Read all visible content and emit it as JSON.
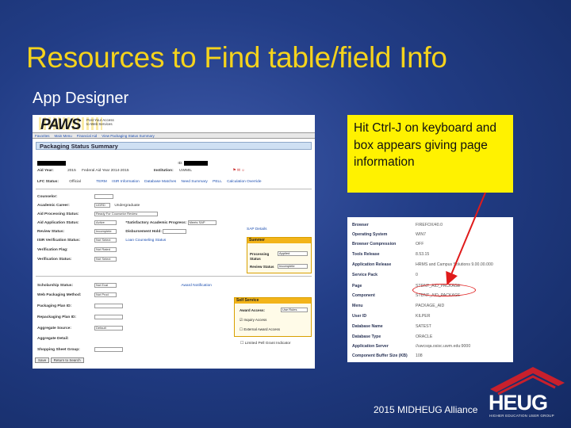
{
  "slide": {
    "title": "Resources to Find table/field Info",
    "subtitle": "App Designer",
    "note": "Hit Ctrl-J on keyboard and box appears giving page information",
    "footer": "2015 MIDHEUG Alliance"
  },
  "colors": {
    "title": "#f5d31c",
    "note_bg": "#fff200",
    "highlight": "#e01b1b",
    "logo_red": "#c8202c"
  },
  "paws": {
    "logo": "PAWS",
    "tagline": "Post Your Access\nto Web Services",
    "nav": [
      "Favorites",
      "Main Menu",
      "Financial Aid",
      "View Packaging Status Summary"
    ],
    "page_title": "Packaging Status Summary",
    "id_label": "ID:",
    "aid_year_label": "Aid Year:",
    "aid_year_value": "2015",
    "aid_year_desc": "Federal Aid Year 2014-2015",
    "institution_label": "Institution:",
    "institution_value": "UWMIL",
    "lfc_label": "LFC Status:",
    "lfc_value": "Official",
    "links": [
      "TERM",
      "ISIR Information",
      "Database Matches",
      "Need Summary",
      "PELL",
      "Calculation Override"
    ],
    "fields": [
      {
        "label": "Counselor:",
        "value": ""
      },
      {
        "label": "Academic Career:",
        "value": "UGRD",
        "desc": "Undergraduate"
      },
      {
        "label": "Aid Processing Status:",
        "value": "Ready For Counselor Review"
      },
      {
        "label": "Aid Application Status:",
        "value": "Active"
      },
      {
        "label": "Review Status:",
        "value": "Incomplete"
      },
      {
        "label": "ISIR Verification Status:",
        "value": "Not Select"
      },
      {
        "label": "Verification Flag:",
        "value": "Not Rated"
      },
      {
        "label": "Verification Status:",
        "value": "Not Select"
      }
    ],
    "sap_label": "*Satisfactory Academic Progress:",
    "sap_value": "Meets SAP",
    "sap_link": "SAP Details",
    "disbursement_label": "Disbursement Hold:",
    "loan_link": "Loan Counseling Status",
    "summer_box": {
      "title": "Summer",
      "processing_label": "Processing Status",
      "processing_value": "Applied",
      "review_label": "Review Status",
      "review_value": "Incomplete"
    },
    "fields2": [
      {
        "label": "Scholarship Status:",
        "value": "Not Eval"
      },
      {
        "label": "Web Packaging Method:",
        "value": "Not Prod"
      },
      {
        "label": "Packaging Plan ID:",
        "value": ""
      },
      {
        "label": "Repackaging Plan ID:",
        "value": ""
      },
      {
        "label": "Aggregate Source:",
        "value": "Default"
      },
      {
        "label": "Aggregate Detail:",
        "value": ""
      },
      {
        "label": "Shopping Sheet Group:",
        "value": ""
      }
    ],
    "award_link": "Award Notification",
    "self_service": {
      "title": "Self Service",
      "award_access_label": "Award Access:",
      "award_access_value": "Use Rules",
      "inquiry": "Inquiry Access",
      "external": "External Award Access",
      "pell": "Limited Pell Grant Indicator"
    },
    "buttons": [
      "Save",
      "Return to Search"
    ]
  },
  "info_panel": {
    "rows": [
      {
        "k": "Browser",
        "v": "FIREFOX/40.0"
      },
      {
        "k": "Operating System",
        "v": "WIN7"
      },
      {
        "k": "Browser Compression",
        "v": "OFF"
      },
      {
        "k": "Tools Release",
        "v": "8.53.15"
      },
      {
        "k": "Application Release",
        "v": "HRMS and Campus Solutions 9.00.00.000"
      },
      {
        "k": "Service Pack",
        "v": "0"
      },
      {
        "k": "Page",
        "v": "STDNT_AID_PACKAGE"
      },
      {
        "k": "Component",
        "v": "STDNT_AID_PACKAGE"
      },
      {
        "k": "Menu",
        "v": "PACKAGE_AID"
      },
      {
        "k": "User ID",
        "v": "KILPER"
      },
      {
        "k": "Database Name",
        "v": "SATEST"
      },
      {
        "k": "Database Type",
        "v": "ORACLE"
      },
      {
        "k": "Application Server",
        "v": "//uwcsqa.osisc.uwm.edu:9000"
      },
      {
        "k": "Component Buffer Size (KB)",
        "v": "108"
      }
    ]
  },
  "logo": {
    "word": "HEUG",
    "tagline": "HIGHER EDUCATION USER GROUP"
  }
}
